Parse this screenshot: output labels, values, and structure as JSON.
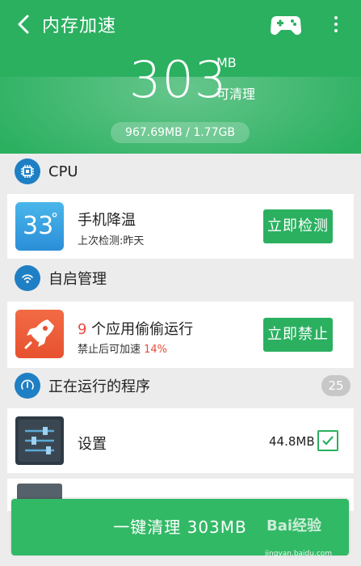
{
  "header": {
    "title": "内存加速",
    "releasable_amount": "303",
    "unit": "MB",
    "releasable_label": "可清理",
    "memory_usage": "967.69MB / 1.77GB",
    "back_icon": "chevron-left-icon",
    "game_icon": "gamepad-icon",
    "more_icon": "more-vertical-icon"
  },
  "cpu_section": {
    "title": "CPU",
    "icon": "cpu-chip-icon",
    "card": {
      "temperature": "33",
      "temperature_unit": "°",
      "title": "手机降温",
      "subtitle": "上次检测:昨天",
      "button_label": "立即检测"
    }
  },
  "autostart_section": {
    "title": "自启管理",
    "icon": "wifi-signal-icon",
    "card": {
      "app_count": "9",
      "title_suffix": " 个应用偷偷运行",
      "subtitle_prefix": "禁止后可加速 ",
      "speedup_percent": "14%",
      "button_label": "立即禁止",
      "icon": "rocket-icon"
    }
  },
  "running_section": {
    "title": "正在运行的程序",
    "count": "25",
    "icon": "gauge-icon",
    "items": [
      {
        "name": "设置",
        "size": "44.8MB",
        "checked": true,
        "icon": "settings-sliders-icon"
      }
    ]
  },
  "footer": {
    "clean_button_label": "一键清理 303MB",
    "watermark_main": "Bai经验",
    "watermark_sub": "jingyan.baidu.com"
  },
  "colors": {
    "accent_green": "#2bb060",
    "warning_red": "#e74c3c",
    "icon_blue": "#1f7fc4"
  }
}
